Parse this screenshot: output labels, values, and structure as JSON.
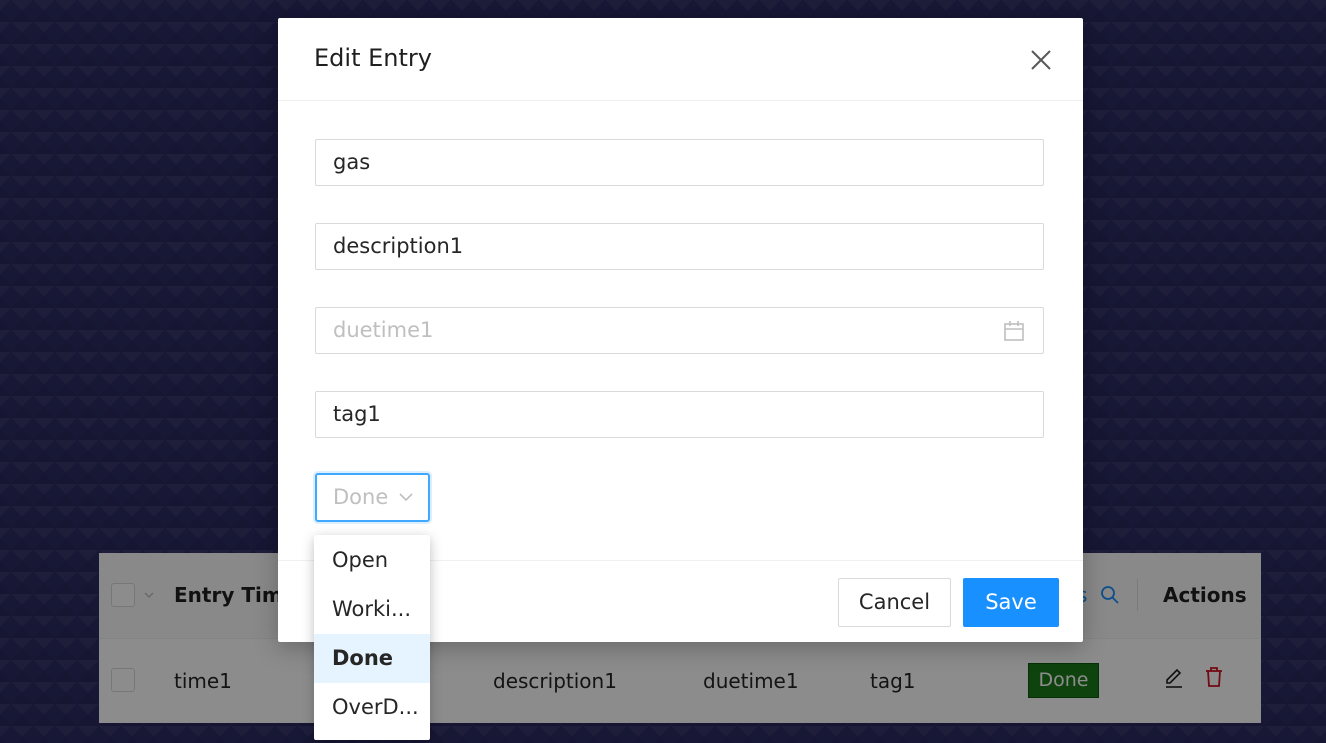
{
  "table": {
    "headers": {
      "entry_time": "Entry Time",
      "status_partial": "s",
      "actions": "Actions"
    },
    "row": {
      "entry_time": "time1",
      "description": "description1",
      "duetime": "duetime1",
      "tag": "tag1",
      "status": "Done"
    },
    "colors": {
      "done_tag": "#1a7a1a",
      "delete_icon": "#cf1322",
      "search_icon": "#1890ff"
    }
  },
  "modal": {
    "title": "Edit Entry",
    "fields": {
      "name_value": "gas",
      "description_value": "description1",
      "duetime_placeholder": "duetime1",
      "tag_value": "tag1"
    },
    "status_select": {
      "value": "Done"
    },
    "status_options": [
      "Open",
      "Worki...",
      "Done",
      "OverD..."
    ],
    "selected_option": "Done",
    "cancel_label": "Cancel",
    "save_label": "Save",
    "colors": {
      "primary": "#1890ff",
      "selected_option_bg": "#e6f4ff"
    }
  },
  "icons": {
    "close": "close-icon",
    "calendar": "calendar-icon",
    "chevron": "chevron-down-icon",
    "search": "search-icon",
    "edit": "edit-icon",
    "delete": "delete-icon"
  }
}
